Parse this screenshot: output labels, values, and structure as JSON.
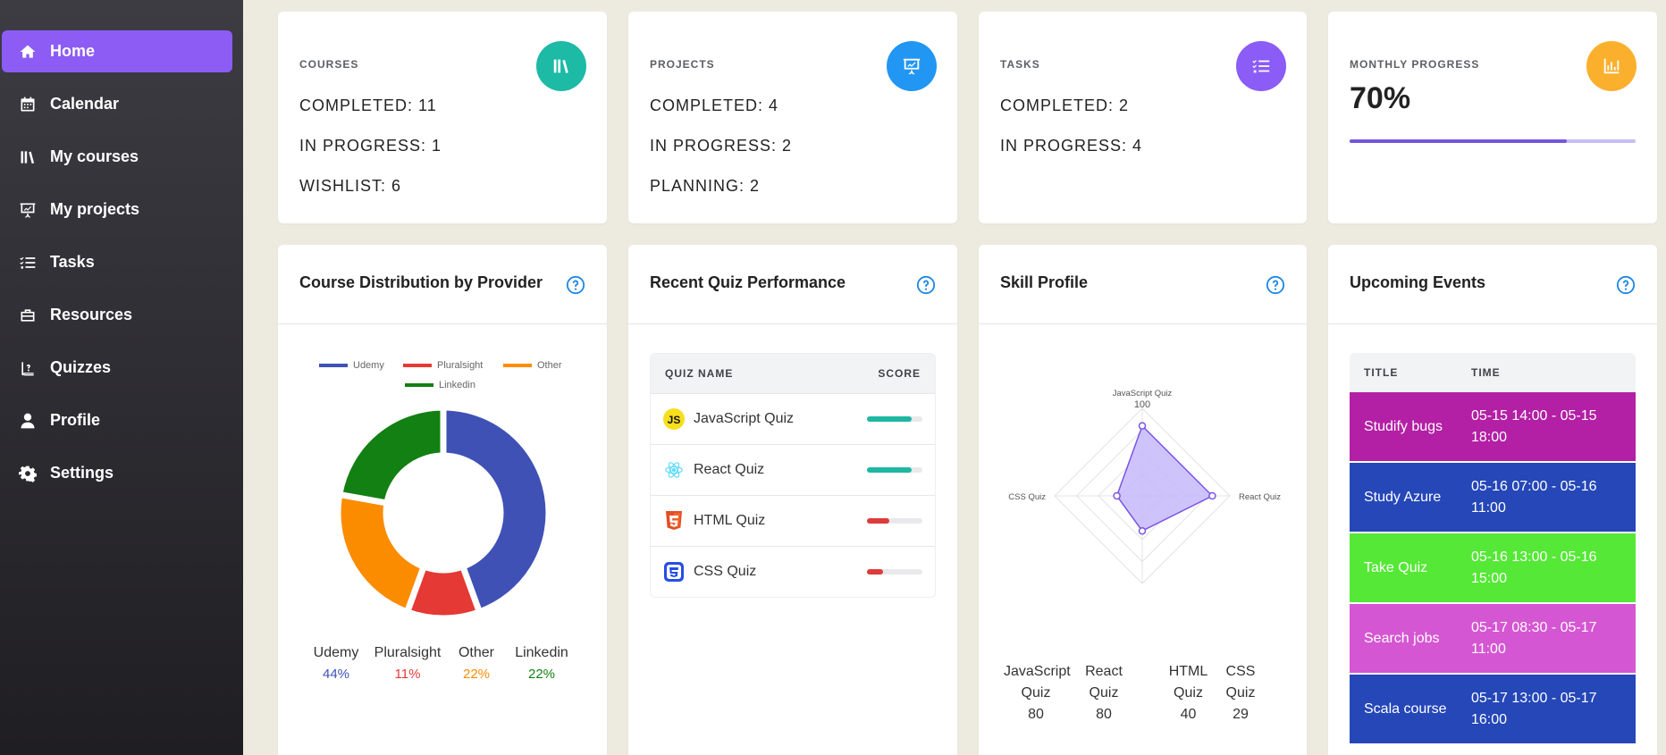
{
  "sidebar": {
    "items": [
      {
        "label": "Home",
        "icon": "home-icon",
        "active": true
      },
      {
        "label": "Calendar",
        "icon": "calendar-icon",
        "active": false
      },
      {
        "label": "My courses",
        "icon": "books-icon",
        "active": false
      },
      {
        "label": "My projects",
        "icon": "presentation-icon",
        "active": false
      },
      {
        "label": "Tasks",
        "icon": "tasks-list-icon",
        "active": false
      },
      {
        "label": "Resources",
        "icon": "briefcase-icon",
        "active": false
      },
      {
        "label": "Quizzes",
        "icon": "quiz-book-icon",
        "active": false
      },
      {
        "label": "Profile",
        "icon": "user-icon",
        "active": false
      },
      {
        "label": "Settings",
        "icon": "gear-icon",
        "active": false
      }
    ],
    "active_color": "#8c5cf5"
  },
  "stats": {
    "courses": {
      "label": "COURSES",
      "lines": [
        "COMPLETED: 11",
        "IN PROGRESS: 1",
        "WISHLIST: 6"
      ],
      "icon": "books-icon",
      "color": "#1dbaa6"
    },
    "projects": {
      "label": "PROJECTS",
      "lines": [
        "COMPLETED: 4",
        "IN PROGRESS: 2",
        "PLANNING: 2"
      ],
      "icon": "presentation-icon",
      "color": "#2196f3"
    },
    "tasks": {
      "label": "TASKS",
      "lines": [
        "COMPLETED: 2",
        "IN PROGRESS: 4"
      ],
      "icon": "tasks-list-icon",
      "color": "#8b5cf6"
    },
    "monthly": {
      "label": "MONTHLY PROGRESS",
      "value": "70%",
      "progress_fraction": 0.76,
      "icon": "bar-chart-icon",
      "color": "#fbb02d"
    }
  },
  "distribution": {
    "title": "Course Distribution by Provider",
    "legend": [
      {
        "name": "Udemy",
        "color": "#3f51b5"
      },
      {
        "name": "Pluralsight",
        "color": "#e53935"
      },
      {
        "name": "Other",
        "color": "#fb8c00"
      },
      {
        "name": "Linkedin",
        "color": "#128012"
      }
    ],
    "summary": [
      {
        "name": "Udemy",
        "pct": "44%",
        "color": "#3f51b5"
      },
      {
        "name": "Pluralsight",
        "pct": "11%",
        "color": "#e53935"
      },
      {
        "name": "Other",
        "pct": "22%",
        "color": "#fb8c00"
      },
      {
        "name": "Linkedin",
        "pct": "22%",
        "color": "#128012"
      }
    ]
  },
  "quiz": {
    "title": "Recent Quiz Performance",
    "col_name": "QUIZ NAME",
    "col_score": "SCORE",
    "rows": [
      {
        "name": "JavaScript Quiz",
        "icon": "javascript-icon",
        "score": 80,
        "color": "#1fb7a3"
      },
      {
        "name": "React Quiz",
        "icon": "react-icon",
        "score": 80,
        "color": "#1fb7a3"
      },
      {
        "name": "HTML Quiz",
        "icon": "html5-icon",
        "score": 40,
        "color": "#dc3c3c"
      },
      {
        "name": "CSS Quiz",
        "icon": "css3-icon",
        "score": 29,
        "color": "#dc3c3c"
      }
    ]
  },
  "skills": {
    "title": "Skill Profile",
    "radar_tick": "100",
    "radar_max": 100,
    "axes": [
      {
        "label": "JavaScript Quiz",
        "value": 80
      },
      {
        "label": "React Quiz",
        "value": 80
      },
      {
        "label": "HTML Quiz",
        "value": 40
      },
      {
        "label": "CSS Quiz",
        "value": 29
      }
    ],
    "summary": [
      {
        "l1": "JavaScript",
        "l2": "Quiz",
        "v": "80"
      },
      {
        "l1": "React",
        "l2": "Quiz",
        "v": "80"
      },
      {
        "l1": "HTML",
        "l2": "Quiz",
        "v": "40"
      },
      {
        "l1": "CSS",
        "l2": "Quiz",
        "v": "29"
      }
    ],
    "fill_color": "#c7b8fb",
    "stroke_color": "#7a55e6"
  },
  "events": {
    "title": "Upcoming Events",
    "col_title": "TITLE",
    "col_time": "TIME",
    "rows": [
      {
        "title": "Studify bugs",
        "time": "05-15 14:00 - 05-15 18:00",
        "color": "#b31fa5"
      },
      {
        "title": "Study Azure",
        "time": "05-16 07:00 - 05-16 11:00",
        "color": "#2547b8"
      },
      {
        "title": "Take Quiz",
        "time": "05-16 13:00 - 05-16 15:00",
        "color": "#55e836"
      },
      {
        "title": "Search jobs",
        "time": "05-17 08:30 - 05-17 11:00",
        "color": "#d556d2"
      },
      {
        "title": "Scala course",
        "time": "05-17 13:00 - 05-17 16:00",
        "color": "#2547b8"
      }
    ]
  },
  "chart_data": [
    {
      "type": "pie",
      "categories": [
        "Udemy",
        "Pluralsight",
        "Other",
        "Linkedin"
      ],
      "values": [
        44,
        11,
        22,
        22
      ],
      "title": "Course Distribution by Provider",
      "donut": true,
      "legend_position": "top"
    },
    {
      "type": "radar",
      "categories": [
        "JavaScript Quiz",
        "React Quiz",
        "HTML Quiz",
        "CSS Quiz"
      ],
      "values": [
        80,
        80,
        40,
        29
      ],
      "title": "Skill Profile",
      "rmax": 100
    }
  ]
}
